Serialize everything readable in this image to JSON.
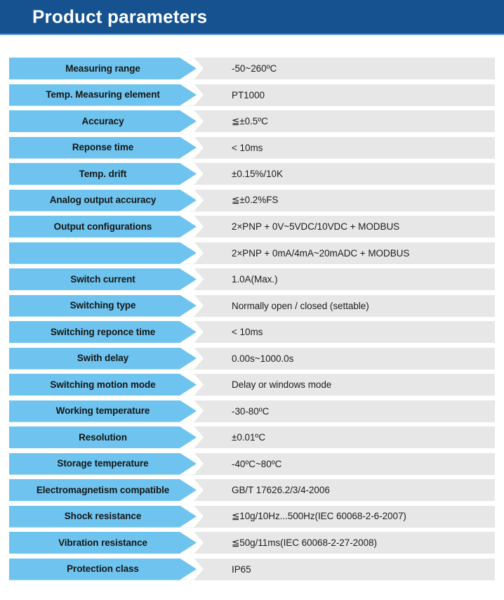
{
  "header": {
    "title": "Product parameters",
    "background_color": "#16528f",
    "underline_color": "#6ba3d6",
    "text_color": "#ffffff"
  },
  "table": {
    "label_color": "#6ec4ef",
    "value_band_color": "#e7e7e7",
    "label_text_color": "#161616",
    "value_text_color": "#1d1d1d",
    "rows": [
      {
        "label": "Measuring range",
        "value": "-50~260ºC"
      },
      {
        "label": "Temp. Measuring element",
        "value": "PT1000"
      },
      {
        "label": "Accuracy",
        "value": "≦±0.5ºC"
      },
      {
        "label": "Reponse time",
        "value": "< 10ms"
      },
      {
        "label": "Temp. drift",
        "value": "±0.15%/10K"
      },
      {
        "label": "Analog output accuracy",
        "value": "≦±0.2%FS"
      },
      {
        "label": "Output configurations",
        "value": "2×PNP + 0V~5VDC/10VDC + MODBUS"
      },
      {
        "label": "",
        "value": "2×PNP + 0mA/4mA~20mADC + MODBUS"
      },
      {
        "label": "Switch current",
        "value": "1.0A(Max.)"
      },
      {
        "label": "Switching type",
        "value": "Normally open / closed (settable)"
      },
      {
        "label": "Switching reponce time",
        "value": "< 10ms"
      },
      {
        "label": "Swith delay",
        "value": "0.00s~1000.0s"
      },
      {
        "label": "Switching motion mode",
        "value": "Delay or windows mode"
      },
      {
        "label": "Working temperature",
        "value": "-30-80ºC"
      },
      {
        "label": "Resolution",
        "value": "±0.01ºC"
      },
      {
        "label": "Storage temperature",
        "value": "-40ºC~80ºC"
      },
      {
        "label": "Electromagnetism compatible",
        "value": "GB/T 17626.2/3/4-2006"
      },
      {
        "label": "Shock resistance",
        "value": "≦10g/10Hz...500Hz(IEC 60068-2-6-2007)"
      },
      {
        "label": "Vibration resistance",
        "value": "≦50g/11ms(IEC 60068-2-27-2008)"
      },
      {
        "label": "Protection class",
        "value": "IP65"
      }
    ]
  }
}
